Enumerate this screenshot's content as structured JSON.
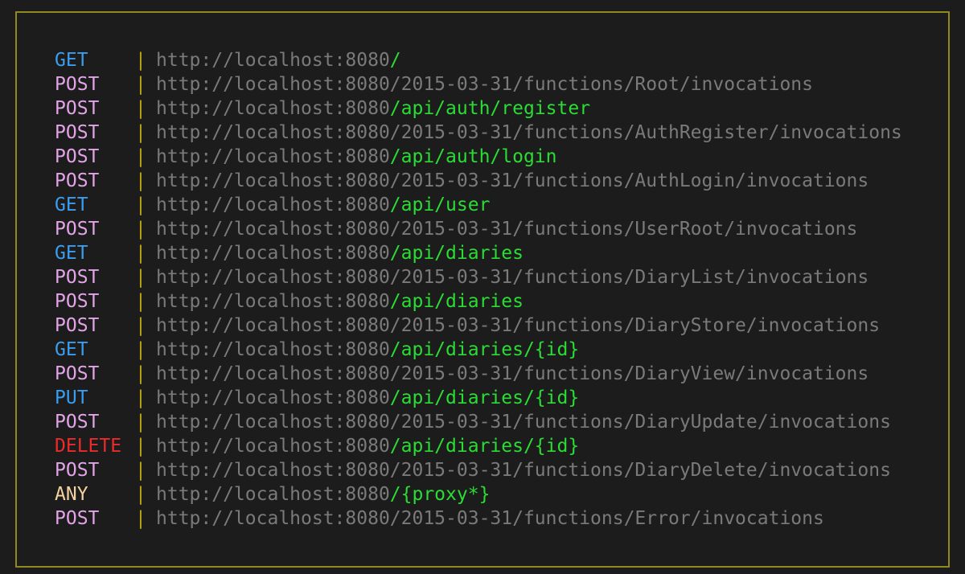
{
  "colors": {
    "background": "#1c1c1c",
    "border": "#8f8a1e",
    "separator": "#b9a40f",
    "host": "#7a7a7a",
    "app_path": "#2bdc35",
    "methods": {
      "GET": "#3a9ef0",
      "POST": "#e2a4e6",
      "PUT": "#3a9ef0",
      "DELETE": "#ec2b2b",
      "ANY": "#f3d2a2"
    }
  },
  "separator": "|",
  "host": "http://localhost:8080",
  "routes": [
    {
      "method": "GET",
      "path": "/",
      "kind": "app"
    },
    {
      "method": "POST",
      "path": "/2015-03-31/functions/Root/invocations",
      "kind": "fn"
    },
    {
      "method": "POST",
      "path": "/api/auth/register",
      "kind": "app"
    },
    {
      "method": "POST",
      "path": "/2015-03-31/functions/AuthRegister/invocations",
      "kind": "fn"
    },
    {
      "method": "POST",
      "path": "/api/auth/login",
      "kind": "app"
    },
    {
      "method": "POST",
      "path": "/2015-03-31/functions/AuthLogin/invocations",
      "kind": "fn"
    },
    {
      "method": "GET",
      "path": "/api/user",
      "kind": "app"
    },
    {
      "method": "POST",
      "path": "/2015-03-31/functions/UserRoot/invocations",
      "kind": "fn"
    },
    {
      "method": "GET",
      "path": "/api/diaries",
      "kind": "app"
    },
    {
      "method": "POST",
      "path": "/2015-03-31/functions/DiaryList/invocations",
      "kind": "fn"
    },
    {
      "method": "POST",
      "path": "/api/diaries",
      "kind": "app"
    },
    {
      "method": "POST",
      "path": "/2015-03-31/functions/DiaryStore/invocations",
      "kind": "fn"
    },
    {
      "method": "GET",
      "path": "/api/diaries/{id}",
      "kind": "app"
    },
    {
      "method": "POST",
      "path": "/2015-03-31/functions/DiaryView/invocations",
      "kind": "fn"
    },
    {
      "method": "PUT",
      "path": "/api/diaries/{id}",
      "kind": "app"
    },
    {
      "method": "POST",
      "path": "/2015-03-31/functions/DiaryUpdate/invocations",
      "kind": "fn"
    },
    {
      "method": "DELETE",
      "path": "/api/diaries/{id}",
      "kind": "app"
    },
    {
      "method": "POST",
      "path": "/2015-03-31/functions/DiaryDelete/invocations",
      "kind": "fn"
    },
    {
      "method": "ANY",
      "path": "/{proxy*}",
      "kind": "app"
    },
    {
      "method": "POST",
      "path": "/2015-03-31/functions/Error/invocations",
      "kind": "fn"
    }
  ]
}
